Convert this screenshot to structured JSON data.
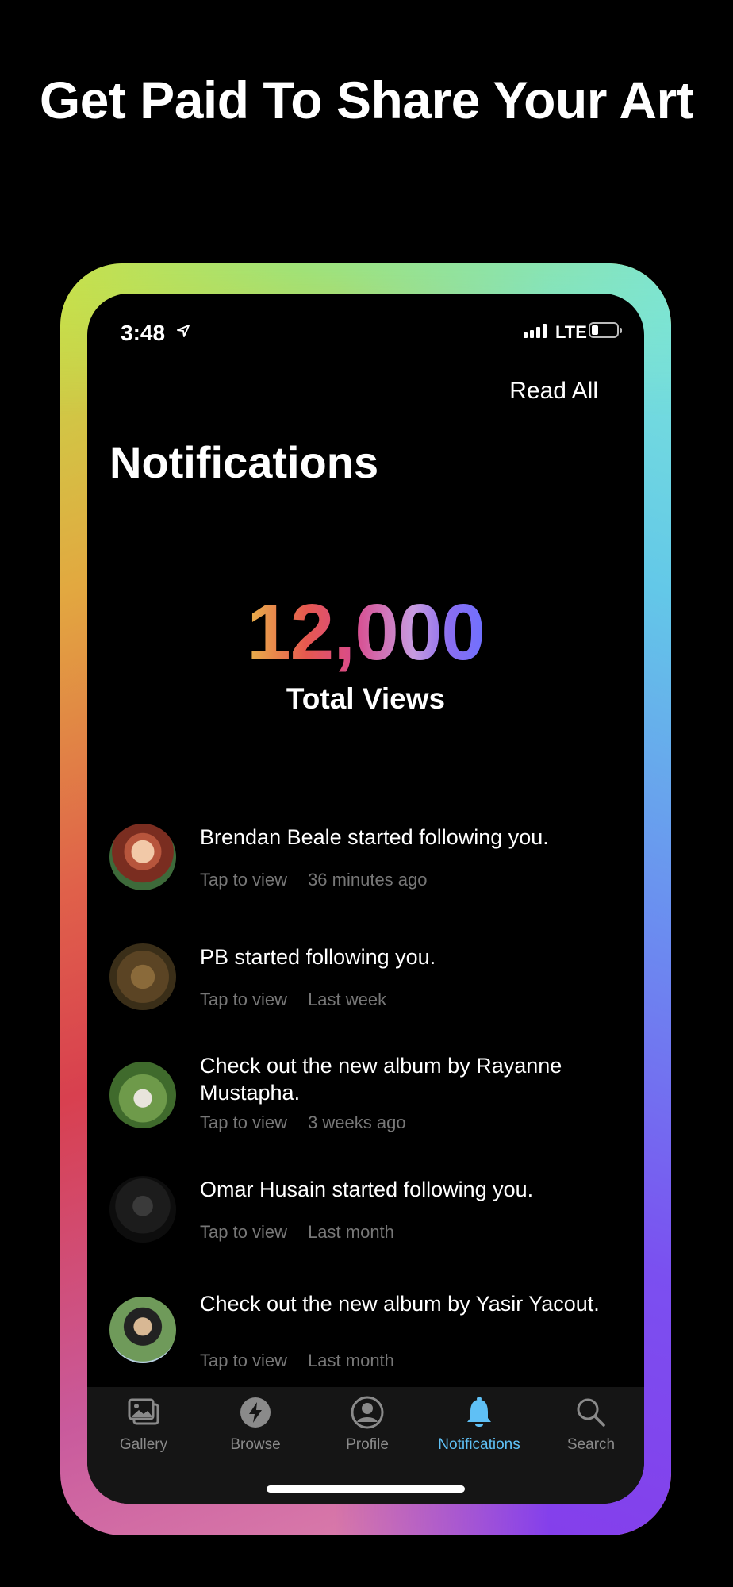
{
  "promo": {
    "headline": "Get Paid To Share Your Art"
  },
  "status_bar": {
    "time": "3:48",
    "network": "LTE"
  },
  "header": {
    "read_all_label": "Read All",
    "title": "Notifications"
  },
  "stats": {
    "total_views": "12,000",
    "total_views_label": "Total Views"
  },
  "notifications": [
    {
      "text": "Brendan Beale started following you.",
      "action": "Tap to view",
      "time": "36 minutes ago"
    },
    {
      "text": "PB started following you.",
      "action": "Tap to view",
      "time": "Last week"
    },
    {
      "text": "Check out the new album by Rayanne Mustapha.",
      "action": "Tap to view",
      "time": "3 weeks ago"
    },
    {
      "text": "Omar Husain started following you.",
      "action": "Tap to view",
      "time": "Last month"
    },
    {
      "text": "Check out the new album by Yasir Yacout.",
      "action": "Tap to view",
      "time": "Last month"
    }
  ],
  "tabs": [
    {
      "label": "Gallery",
      "icon": "gallery-icon"
    },
    {
      "label": "Browse",
      "icon": "lightning-icon"
    },
    {
      "label": "Profile",
      "icon": "profile-icon"
    },
    {
      "label": "Notifications",
      "icon": "bell-icon",
      "active": true
    },
    {
      "label": "Search",
      "icon": "search-icon"
    }
  ],
  "colors": {
    "active_tab": "#5fc0f5",
    "meta_text": "#777777"
  }
}
